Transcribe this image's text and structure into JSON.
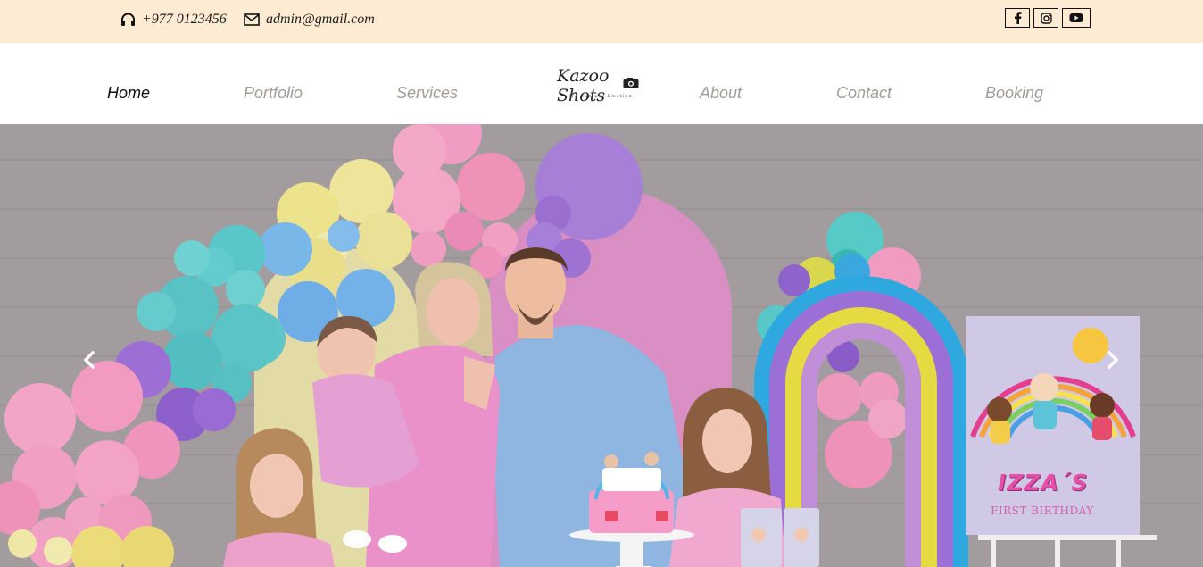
{
  "topbar": {
    "phone": "+977 0123456",
    "email": "admin@gmail.com",
    "socials": [
      {
        "name": "facebook",
        "icon": "facebook-icon"
      },
      {
        "name": "instagram",
        "icon": "instagram-icon"
      },
      {
        "name": "youtube",
        "icon": "youtube-icon"
      }
    ],
    "background": "#fdebd3"
  },
  "nav": {
    "items": [
      {
        "label": "Home",
        "active": true
      },
      {
        "label": "Portfolio",
        "active": false
      },
      {
        "label": "Services",
        "active": false
      },
      {
        "label": "About",
        "active": false
      },
      {
        "label": "Contact",
        "active": false
      },
      {
        "label": "Booking",
        "active": false
      }
    ],
    "logo": {
      "text": "Kazoo Shots",
      "tagline": "We Capture Emotion"
    },
    "active_color": "#111111",
    "inactive_color": "#a39c95"
  },
  "hero": {
    "sign_title": "IZZA´S",
    "sign_subtitle": "FIRST BIRTHDAY",
    "prev_icon": "chevron-left-icon",
    "next_icon": "chevron-right-icon"
  }
}
